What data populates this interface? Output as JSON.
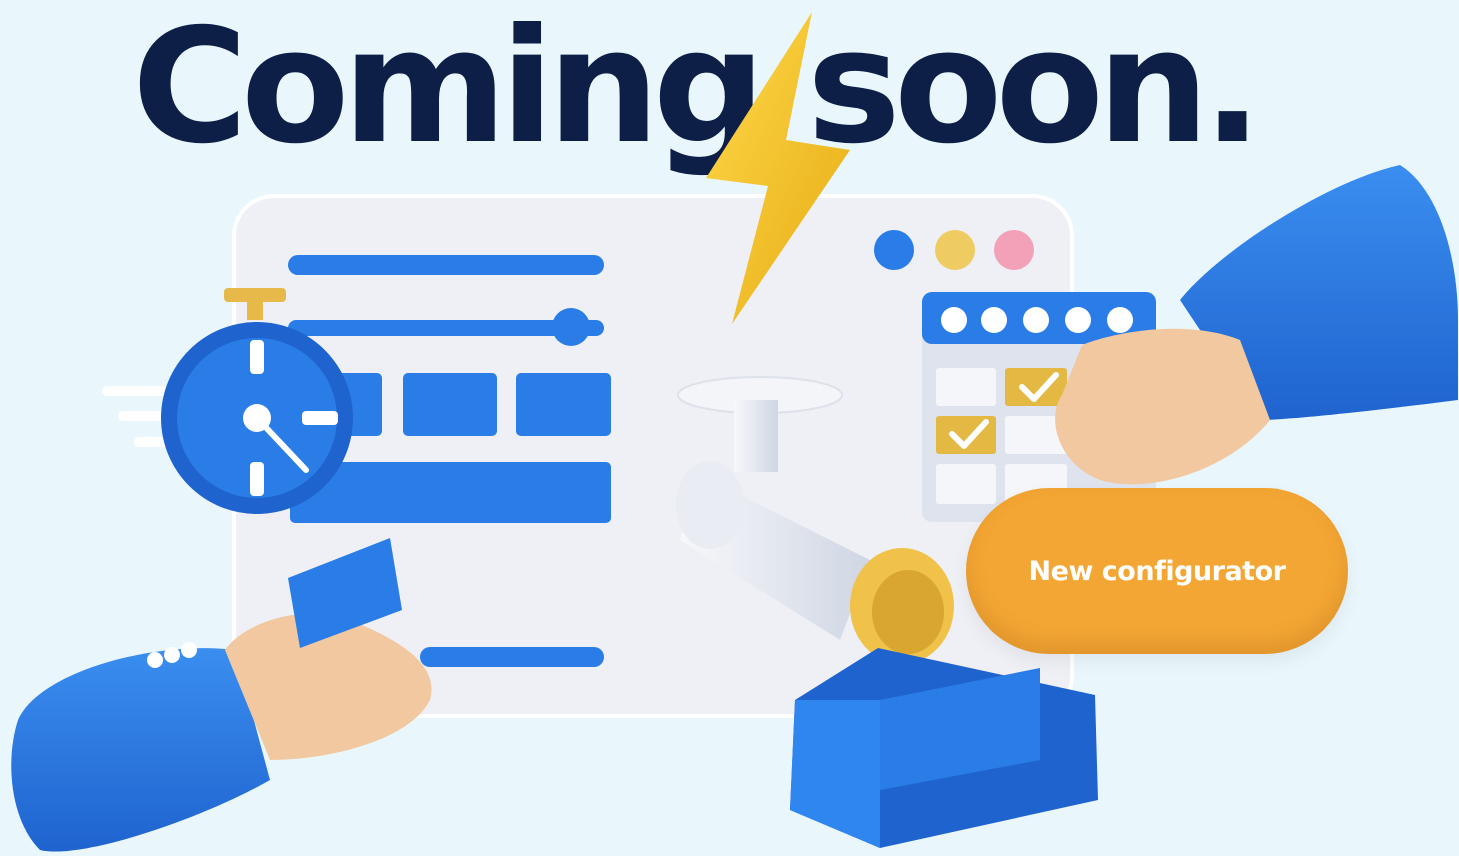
{
  "headline": "Coming soon.",
  "cta": {
    "label": "New configurator"
  },
  "colors": {
    "background": "#e9f7fd",
    "headline": "#0d1e47",
    "accent_blue": "#2a7de6",
    "accent_orange": "#f3a634",
    "bolt_yellow": "#f5c326"
  },
  "icons": [
    "lightning-bolt-icon",
    "stopwatch-icon",
    "calendar-icon",
    "check-icon",
    "window-dots-icon",
    "pipe-icon",
    "box-icon",
    "hand-icon"
  ]
}
